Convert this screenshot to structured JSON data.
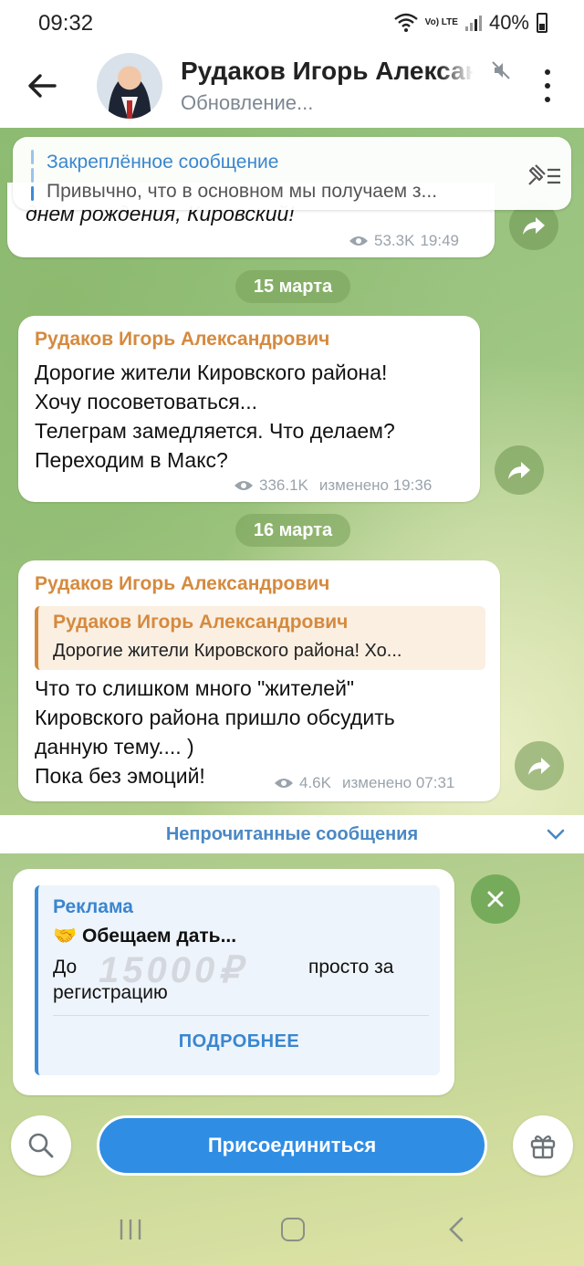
{
  "status_bar": {
    "time": "09:32",
    "network": "Vo) LTE",
    "battery": "40%"
  },
  "header": {
    "name": "Рудаков Игорь Александрович",
    "subtitle": "Обновление..."
  },
  "pinned": {
    "title": "Закреплённое сообщение",
    "text": "Привычно, что в основном мы получаем з..."
  },
  "messages": [
    {
      "body": "днем рождения, Кировский!",
      "views": "53.3K",
      "time": "19:49"
    },
    {
      "date": "15 марта",
      "author": "Рудаков Игорь Александрович",
      "body_lines": [
        "Дорогие жители Кировского района!",
        "Хочу посоветоваться...",
        "Телеграм замедляется. Что делаем?",
        "Переходим в Макс?"
      ],
      "views": "336.1K",
      "time": "изменено 19:36"
    },
    {
      "date": "16 марта",
      "author": "Рудаков Игорь Александрович",
      "quote_author": "Рудаков Игорь Александрович",
      "quote_text": "Дорогие жители Кировского района! Хо...",
      "body_lines": [
        "Что то слишком много \"жителей\"",
        "Кировского района пришло обсудить",
        "данную тему.... )",
        "Пока без эмоций!"
      ],
      "views": "4.6K",
      "time": "изменено 07:31"
    }
  ],
  "unread_label": "Непрочитанные сообщения",
  "ad": {
    "label": "Реклама",
    "title": "🤝 Обещаем дать...",
    "prefix": "До",
    "amount": "15000₽",
    "suffix": "просто за",
    "suffix2": "регистрацию",
    "more": "ПОДРОБНЕЕ"
  },
  "bottom": {
    "join": "Присоединиться"
  },
  "colors": {
    "accent": "#2f8de4",
    "author": "#d58a3e",
    "link": "#3a86cf"
  }
}
